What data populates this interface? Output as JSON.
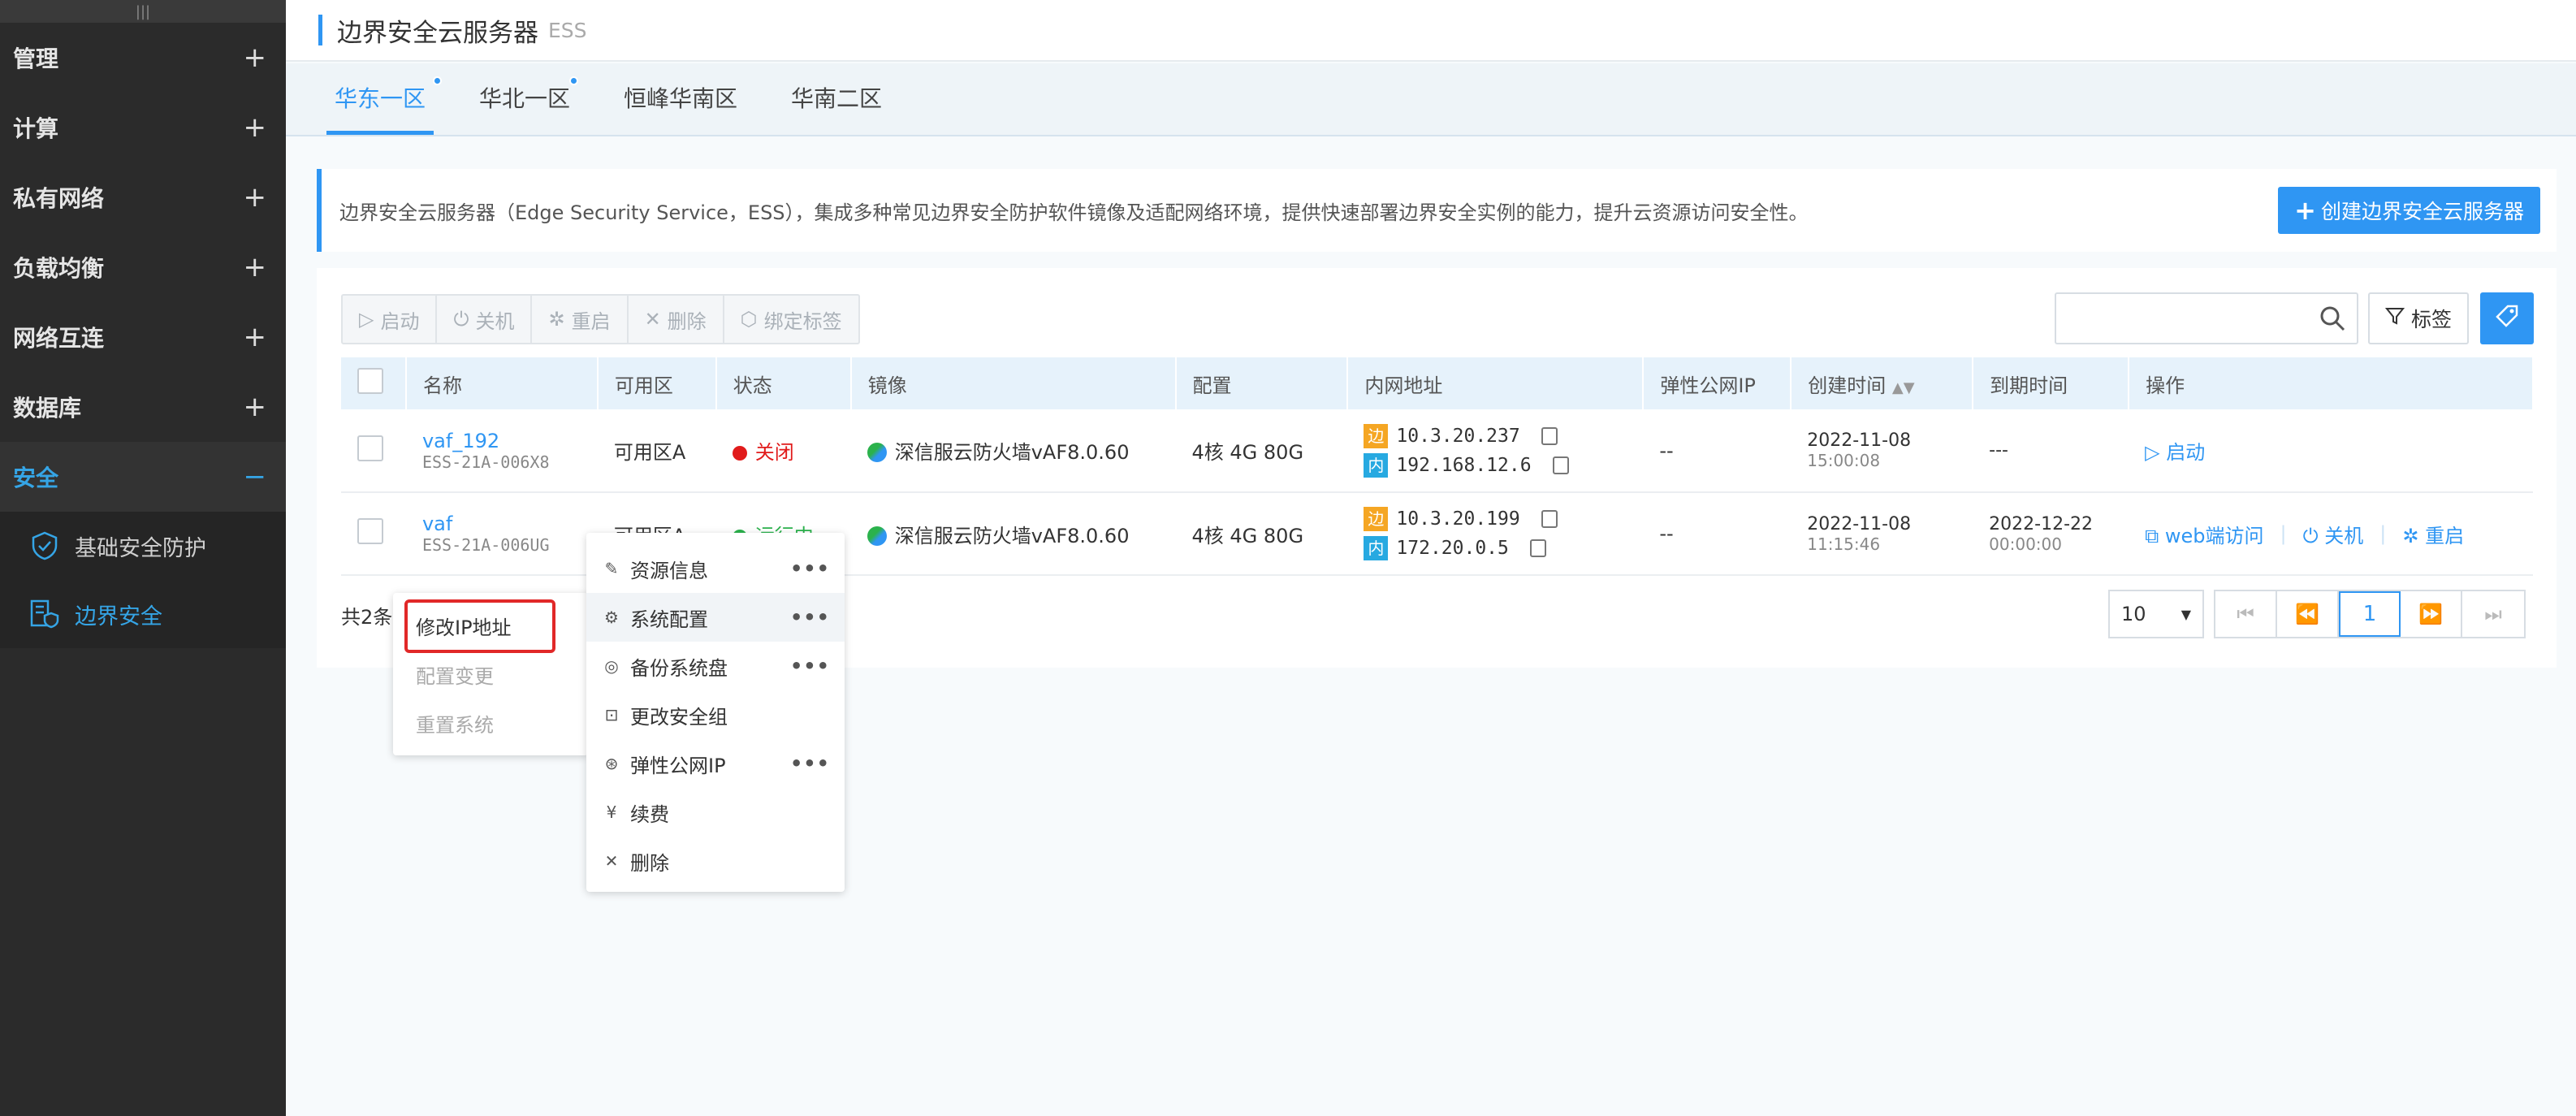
{
  "sidebar": {
    "items": [
      {
        "label": "管理",
        "expander": "+"
      },
      {
        "label": "计算",
        "expander": "+"
      },
      {
        "label": "私有网络",
        "expander": "+"
      },
      {
        "label": "负载均衡",
        "expander": "+"
      },
      {
        "label": "网络互连",
        "expander": "+"
      },
      {
        "label": "数据库",
        "expander": "+"
      },
      {
        "label": "安全",
        "expander": "−"
      }
    ],
    "subitems": [
      {
        "label": "基础安全防护",
        "icon": "shield-check-icon"
      },
      {
        "label": "边界安全",
        "icon": "server-shield-icon"
      }
    ]
  },
  "header": {
    "title": "边界安全云服务器",
    "subtitle": "ESS"
  },
  "tabs": [
    {
      "label": "华东一区"
    },
    {
      "label": "华北一区"
    },
    {
      "label": "恒峰华南区"
    },
    {
      "label": "华南二区"
    }
  ],
  "notice": {
    "text": "边界安全云服务器（Edge Security Service，ESS），集成多种常见边界安全防护软件镜像及适配网络环境，提供快速部署边界安全实例的能力，提升云资源访问安全性。",
    "create_button": "创建边界安全云服务器",
    "create_icon": "+"
  },
  "toolbar": {
    "start": "启动",
    "stop": "关机",
    "restart": "重启",
    "delete": "删除",
    "bind_tag": "绑定标签",
    "tag_button": "标签",
    "icons": {
      "start": "▷",
      "stop": "⏻",
      "restart": "✲",
      "delete": "✕",
      "bind_tag": "⬡"
    }
  },
  "table": {
    "headers": [
      "名称",
      "可用区",
      "状态",
      "镜像",
      "配置",
      "内网地址",
      "弹性公网IP",
      "创建时间",
      "到期时间",
      "操作"
    ],
    "rows": [
      {
        "name": "vaf_192",
        "id": "ESS-21A-006X8",
        "zone": "可用区A",
        "status": "关闭",
        "status_color": "#e11b1b",
        "image": "深信服云防火墙vAF8.0.60",
        "config": "4核 4G 80G",
        "ip_edge_badge": "边",
        "ip_edge": "10.3.20.237",
        "ip_inner_badge": "内",
        "ip_inner": "192.168.12.6",
        "eip": "--",
        "created_date": "2022-11-08",
        "created_time": "15:00:08",
        "expire_date": "---",
        "expire_time": "",
        "ops": [
          "启动"
        ]
      },
      {
        "name": "vaf",
        "id": "ESS-21A-006UG",
        "zone": "可用区A",
        "status": "运行中",
        "status_color": "#2bb24c",
        "image": "深信服云防火墙vAF8.0.60",
        "config": "4核 4G 80G",
        "ip_edge_badge": "边",
        "ip_edge": "10.3.20.199",
        "ip_inner_badge": "内",
        "ip_inner": "172.20.0.5",
        "eip": "--",
        "created_date": "2022-11-08",
        "created_time": "11:15:46",
        "expire_date": "2022-12-22",
        "expire_time": "00:00:00",
        "ops": [
          "web端访问",
          "关机",
          "重启"
        ]
      }
    ]
  },
  "footer": {
    "total_prefix": "共2条"
  },
  "pager": {
    "page_size": "10",
    "current": "1"
  },
  "context_menu": {
    "items": [
      {
        "label": "资源信息",
        "icon": "✎",
        "more": "•••"
      },
      {
        "label": "系统配置",
        "icon": "⚙",
        "more": "•••"
      },
      {
        "label": "备份系统盘",
        "icon": "◎",
        "more": "•••"
      },
      {
        "label": "更改安全组",
        "icon": "⊡",
        "more": ""
      },
      {
        "label": "弹性公网IP",
        "icon": "⊛",
        "more": "•••"
      },
      {
        "label": "续费",
        "icon": "¥",
        "more": ""
      },
      {
        "label": "删除",
        "icon": "✕",
        "more": ""
      }
    ]
  },
  "submenu": {
    "items": [
      {
        "label": "修改IP地址"
      },
      {
        "label": "配置变更"
      },
      {
        "label": "重置系统"
      }
    ]
  },
  "colors": {
    "accent": "#2f96f3",
    "sidebar_bg": "#2b2b2b",
    "edge_badge": "#f5a623",
    "inner_badge": "#27a9e1",
    "highlight": "#e12828"
  }
}
